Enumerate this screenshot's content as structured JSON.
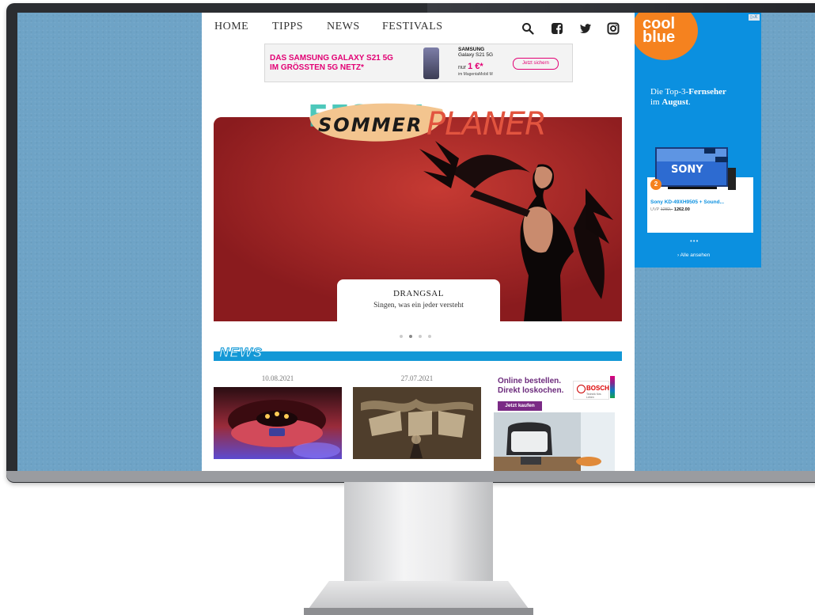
{
  "nav": {
    "items": [
      {
        "label": "HOME"
      },
      {
        "label": "TIPPS"
      },
      {
        "label": "NEWS"
      },
      {
        "label": "FESTIVALS"
      }
    ],
    "icons": [
      "search-icon",
      "facebook-icon",
      "twitter-icon",
      "instagram-icon"
    ]
  },
  "banner_ad": {
    "headline_line1": "DAS SAMSUNG GALAXY S21 5G",
    "headline_line2": "IM GRÖSSTEN 5G NETZ*",
    "brand": "SAMSUNG",
    "model": "Galaxy S21 5G",
    "price_prefix": "nur",
    "price": "1 €*",
    "subline": "im MagentaMobil M",
    "cta": "Jetzt sichern",
    "accent_color": "#e20074"
  },
  "logo": {
    "word1": "SOMMER",
    "word2": "PLANER"
  },
  "hero": {
    "title": "DRANGSAL",
    "subtitle": "Singen, was ein jeder versteht",
    "slides_total": 4,
    "active_slide": 2
  },
  "news": {
    "section_title": "NEWS",
    "articles": [
      {
        "date": "10.08.2021"
      },
      {
        "date": "27.07.2021"
      }
    ],
    "side_ad": {
      "line1": "Online bestellen.",
      "line2": "Direkt loskochen.",
      "brand": "BOSCH",
      "brand_tagline": "Technik fürs Leben",
      "cta": "Jetzt kaufen"
    }
  },
  "right_ad": {
    "brand_line1": "cool",
    "brand_line2": "blue",
    "adchoice": "▷X",
    "tagline_prefix": "Die Top-3-",
    "tagline_bold": "Fernseher",
    "tagline_mid": "im ",
    "tagline_bold2": "August",
    "tagline_end": ".",
    "rank_badge": "2",
    "tv_brand": "SONY",
    "product_name": "Sony KD-49XH9505 + Sound...",
    "uvp_label": "UVP",
    "uvp_old": "1282,-",
    "price": "1262.00",
    "link": "› Alle ansehen",
    "colors": {
      "background": "#0b90e0",
      "badge": "#f5821f"
    }
  }
}
